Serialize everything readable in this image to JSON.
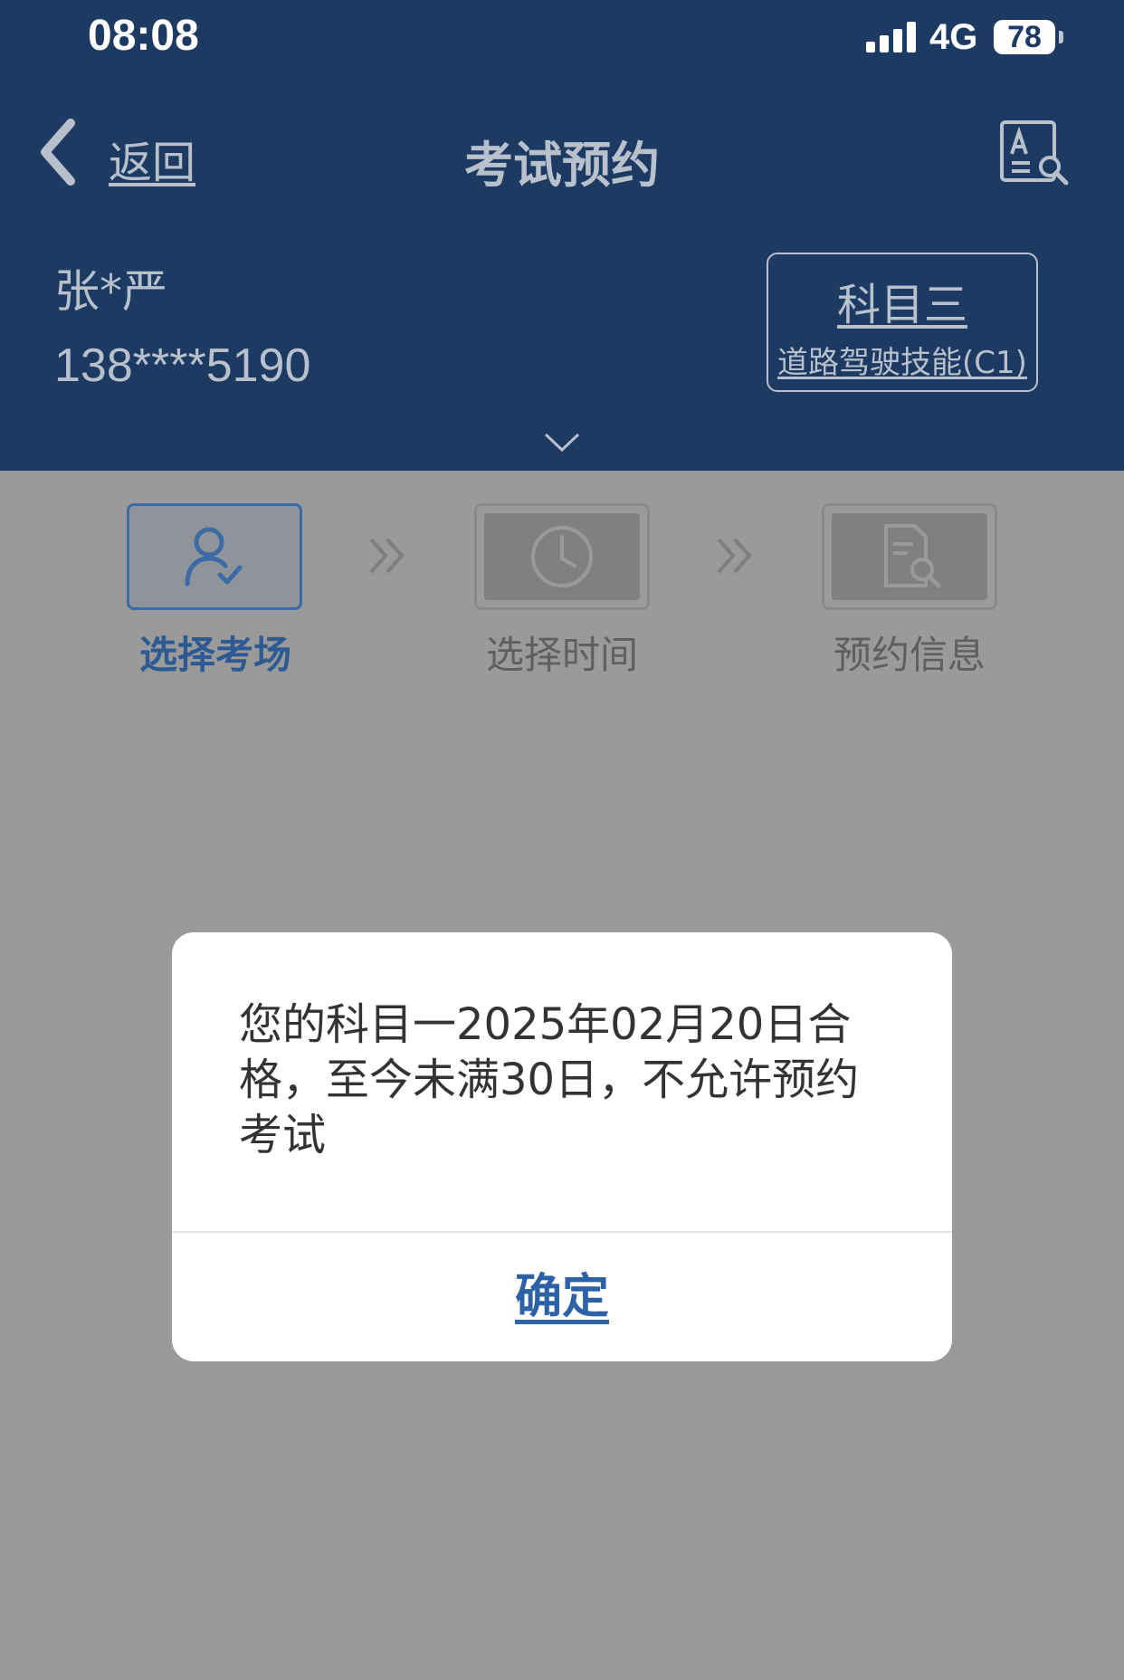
{
  "status_bar": {
    "time": "08:08",
    "network": "4G",
    "battery": "78"
  },
  "nav": {
    "back_label": "返回",
    "title": "考试预约"
  },
  "user": {
    "name": "张*严",
    "phone": "138****5190"
  },
  "subject": {
    "title": "科目三",
    "subtitle": "道路驾驶技能(C1)"
  },
  "steps": [
    {
      "label": "选择考场",
      "icon": "user-check-icon",
      "active": true
    },
    {
      "label": "选择时间",
      "icon": "clock-icon",
      "active": false
    },
    {
      "label": "预约信息",
      "icon": "document-search-icon",
      "active": false
    }
  ],
  "dialog": {
    "message": "您的科目一2025年02月20日合格，至今未满30日，不允许预约考试",
    "confirm_label": "确定"
  },
  "colors": {
    "header_bg": "#1c3a62",
    "overlay_bg": "#9a9a9a",
    "accent": "#2d62a8"
  }
}
